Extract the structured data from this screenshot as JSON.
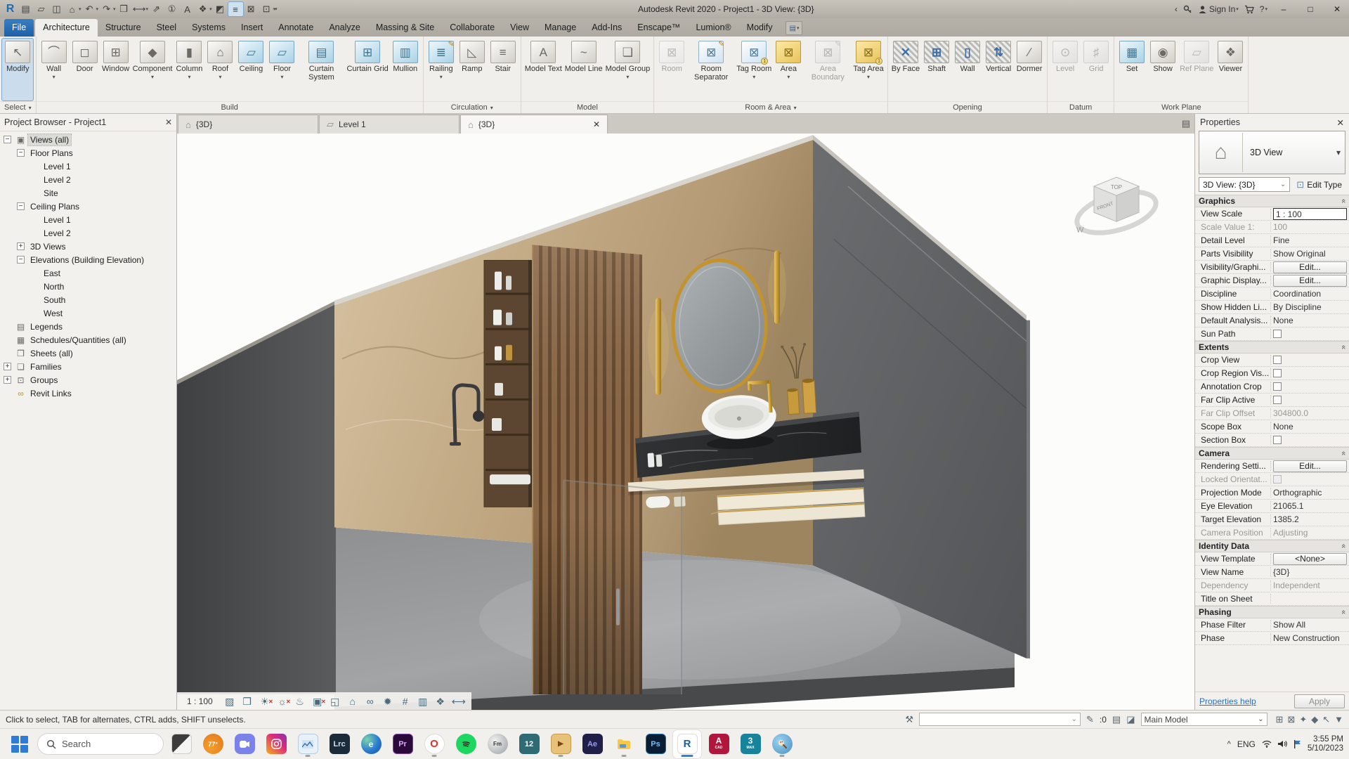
{
  "titlebar": {
    "title": "Autodesk Revit 2020 - Project1 - 3D View: {3D}",
    "sign_in": "Sign In"
  },
  "icons": {
    "caret": "▾",
    "chev": "⌄",
    "close": "✕",
    "min": "–",
    "max": "□",
    "back": "‹",
    "help": "?",
    "collapse": "«",
    "plus": "+",
    "minus": "−",
    "house": "⌂",
    "page": "▱",
    "menu": "▤",
    "qat": {
      "logo": "R",
      "file": "▤",
      "open": "▱",
      "save": "◫",
      "home": "⌂",
      "undo": "↶",
      "redo": "↷",
      "print": "❒",
      "measure": "⟷",
      "dim": "⇗",
      "tag": "①",
      "text": "A",
      "view3d": "❖",
      "section": "◩",
      "thin": "≡",
      "closewin": "⊠",
      "switchwin": "⊡"
    },
    "ribbon": {
      "modify": "↖",
      "wall": "⌒",
      "door": "◻",
      "window": "⊞",
      "component": "◆",
      "column": "▮",
      "roof": "⌂",
      "ceiling": "▱",
      "floor": "▱",
      "cursys": "▤",
      "curgrid": "⊞",
      "mullion": "▥",
      "railing": "≣",
      "ramp": "◺",
      "stair": "≡",
      "mtext": "A",
      "mline": "~",
      "mgroup": "❏",
      "room": "⊠",
      "roomsep": "⊠",
      "tagroom": "⊠",
      "area": "⊠",
      "areab": "⊠",
      "tagarea": "⊠",
      "byface": "✕",
      "shaft": "⊞",
      "wallop": "▯",
      "vertical": "⇅",
      "dormer": "∕",
      "level": "⊙",
      "grid": "♯",
      "set": "▦",
      "show": "◉",
      "refplane": "▱",
      "viewer": "❖",
      "pencil": "✎",
      "one": "1"
    },
    "tree": {
      "views": "▣",
      "legends": "▤",
      "schedules": "▦",
      "sheets": "❒",
      "families": "❏",
      "groups": "⊡",
      "links": "∞"
    },
    "viewbar": {
      "detail": "▨",
      "style": "❒",
      "sun": "☀",
      "shadow": "☼",
      "render": "♨",
      "crop": "▣",
      "cropvis": "◱",
      "lock": "⌂",
      "glasses": "∞",
      "bulb": "✹",
      "constraints": "#",
      "worksharing": "▥",
      "displaced": "❖",
      "measure": "⟷",
      "rx": "✕"
    },
    "status": {
      "worksets": "⚒",
      "editable": "✎",
      "designopt": "▤",
      "activeopt": "◪",
      "links": "⊞",
      "underlay": "⊠",
      "pinned": "✦",
      "byface": "◆",
      "drag": "↖",
      "filter": "▼"
    }
  },
  "ribbon": {
    "tabs": [
      "File",
      "Architecture",
      "Structure",
      "Steel",
      "Systems",
      "Insert",
      "Annotate",
      "Analyze",
      "Massing & Site",
      "Collaborate",
      "View",
      "Manage",
      "Add-Ins",
      "Enscape™",
      "Lumion®",
      "Modify"
    ],
    "panels": [
      {
        "label": "Select",
        "buttons": [
          {
            "label": "Modify"
          }
        ]
      },
      {
        "label": "Build",
        "buttons": [
          {
            "label": "Wall"
          },
          {
            "label": "Door"
          },
          {
            "label": "Window"
          },
          {
            "label": "Component"
          },
          {
            "label": "Column"
          },
          {
            "label": "Roof"
          },
          {
            "label": "Ceiling"
          },
          {
            "label": "Floor"
          },
          {
            "label": "Curtain System"
          },
          {
            "label": "Curtain Grid"
          },
          {
            "label": "Mullion"
          }
        ]
      },
      {
        "label": "Circulation",
        "buttons": [
          {
            "label": "Railing"
          },
          {
            "label": "Ramp"
          },
          {
            "label": "Stair"
          }
        ]
      },
      {
        "label": "Model",
        "buttons": [
          {
            "label": "Model Text"
          },
          {
            "label": "Model Line"
          },
          {
            "label": "Model Group"
          }
        ]
      },
      {
        "label": "Room & Area",
        "buttons": [
          {
            "label": "Room"
          },
          {
            "label": "Room Separator"
          },
          {
            "label": "Tag Room"
          },
          {
            "label": "Area"
          },
          {
            "label": "Area Boundary"
          },
          {
            "label": "Tag Area"
          }
        ]
      },
      {
        "label": "Opening",
        "buttons": [
          {
            "label": "By Face"
          },
          {
            "label": "Shaft"
          },
          {
            "label": "Wall"
          },
          {
            "label": "Vertical"
          },
          {
            "label": "Dormer"
          }
        ]
      },
      {
        "label": "Datum",
        "buttons": [
          {
            "label": "Level"
          },
          {
            "label": "Grid"
          }
        ]
      },
      {
        "label": "Work Plane",
        "buttons": [
          {
            "label": "Set"
          },
          {
            "label": "Show"
          },
          {
            "label": "Ref Plane"
          },
          {
            "label": "Viewer"
          }
        ]
      }
    ]
  },
  "project_browser": {
    "title": "Project Browser - Project1",
    "items": [
      {
        "label": "Views (all)"
      },
      {
        "label": "Floor Plans"
      },
      {
        "label": "Level 1"
      },
      {
        "label": "Level 2"
      },
      {
        "label": "Site"
      },
      {
        "label": "Ceiling Plans"
      },
      {
        "label": "Level 1"
      },
      {
        "label": "Level 2"
      },
      {
        "label": "3D Views"
      },
      {
        "label": "Elevations (Building Elevation)"
      },
      {
        "label": "East"
      },
      {
        "label": "North"
      },
      {
        "label": "South"
      },
      {
        "label": "West"
      },
      {
        "label": "Legends"
      },
      {
        "label": "Schedules/Quantities (all)"
      },
      {
        "label": "Sheets (all)"
      },
      {
        "label": "Families"
      },
      {
        "label": "Groups"
      },
      {
        "label": "Revit Links"
      }
    ]
  },
  "view_tabs": [
    {
      "label": "{3D}"
    },
    {
      "label": "Level 1"
    },
    {
      "label": "{3D}"
    }
  ],
  "viewport": {
    "scale": "1 : 100",
    "viewcube": {
      "top": "TOP",
      "front": "FRONT",
      "west": "W"
    }
  },
  "properties": {
    "title": "Properties",
    "type_name": "3D View",
    "selector": "3D View: {3D}",
    "edit_type": "Edit Type",
    "graphics": {
      "title": "Graphics",
      "rows": [
        {
          "l": "View Scale",
          "v": "1 : 100"
        },
        {
          "l": "Scale Value   1:",
          "v": "100"
        },
        {
          "l": "Detail Level",
          "v": "Fine"
        },
        {
          "l": "Parts Visibility",
          "v": "Show Original"
        },
        {
          "l": "Visibility/Graphi...",
          "v": "Edit..."
        },
        {
          "l": "Graphic Display...",
          "v": "Edit..."
        },
        {
          "l": "Discipline",
          "v": "Coordination"
        },
        {
          "l": "Show Hidden Li...",
          "v": "By Discipline"
        },
        {
          "l": "Default Analysis...",
          "v": "None"
        },
        {
          "l": "Sun Path",
          "v": ""
        }
      ]
    },
    "extents": {
      "title": "Extents",
      "rows": [
        {
          "l": "Crop View",
          "v": ""
        },
        {
          "l": "Crop Region Vis...",
          "v": ""
        },
        {
          "l": "Annotation Crop",
          "v": ""
        },
        {
          "l": "Far Clip Active",
          "v": ""
        },
        {
          "l": "Far Clip Offset",
          "v": "304800.0"
        },
        {
          "l": "Scope Box",
          "v": "None"
        },
        {
          "l": "Section Box",
          "v": ""
        }
      ]
    },
    "camera": {
      "title": "Camera",
      "rows": [
        {
          "l": "Rendering Setti...",
          "v": "Edit..."
        },
        {
          "l": "Locked Orientat...",
          "v": ""
        },
        {
          "l": "Projection Mode",
          "v": "Orthographic"
        },
        {
          "l": "Eye Elevation",
          "v": "21065.1"
        },
        {
          "l": "Target Elevation",
          "v": "1385.2"
        },
        {
          "l": "Camera Position",
          "v": "Adjusting"
        }
      ]
    },
    "identity": {
      "title": "Identity Data",
      "rows": [
        {
          "l": "View Template",
          "v": "<None>"
        },
        {
          "l": "View Name",
          "v": "{3D}"
        },
        {
          "l": "Dependency",
          "v": "Independent"
        },
        {
          "l": "Title on Sheet",
          "v": ""
        }
      ]
    },
    "phasing": {
      "title": "Phasing",
      "rows": [
        {
          "l": "Phase Filter",
          "v": "Show All"
        },
        {
          "l": "Phase",
          "v": "New Construction"
        }
      ]
    },
    "help": "Properties help",
    "apply": "Apply"
  },
  "statusbar": {
    "hint": "Click to select, TAB for alternates, CTRL adds, SHIFT unselects.",
    "editable": ":0",
    "main_model": "Main Model"
  },
  "taskbar": {
    "search": "Search",
    "weather": "77°",
    "tiles": {
      "lrc": "Lrc",
      "pr": "Pr",
      "o": "O",
      "fm": "Fm",
      "l12": "12",
      "ae": "Ae",
      "ps": "Ps",
      "r": "R",
      "a": "A",
      "cad": "CAD",
      "m3": "3",
      "max": "MAX",
      "play": "▶",
      "e": "e"
    },
    "tray": {
      "lang": "ENG",
      "time": "3:55 PM",
      "date": "5/10/2023"
    }
  }
}
